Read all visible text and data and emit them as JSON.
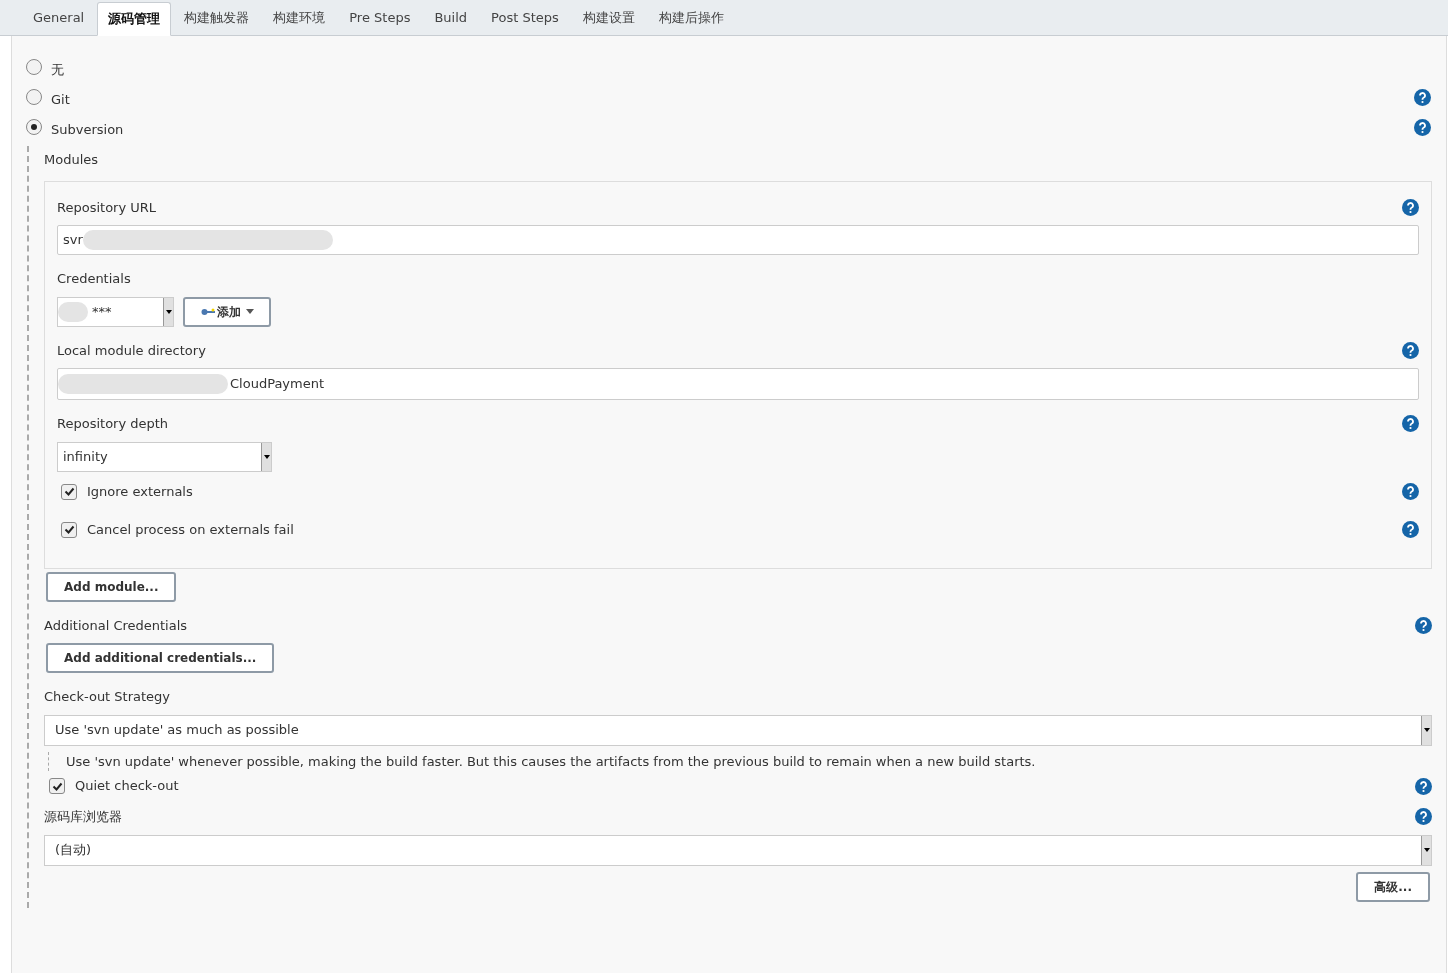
{
  "tabs": [
    {
      "label": "General",
      "selected": false
    },
    {
      "label": "源码管理",
      "selected": true
    },
    {
      "label": "构建触发器",
      "selected": false
    },
    {
      "label": "构建环境",
      "selected": false
    },
    {
      "label": "Pre Steps",
      "selected": false
    },
    {
      "label": "Build",
      "selected": false
    },
    {
      "label": "Post Steps",
      "selected": false
    },
    {
      "label": "构建设置",
      "selected": false
    },
    {
      "label": "构建后操作",
      "selected": false
    }
  ],
  "scm_options": [
    {
      "label": "无",
      "selected": false,
      "help": false
    },
    {
      "label": "Git",
      "selected": false,
      "help": true
    },
    {
      "label": "Subversion",
      "selected": true,
      "help": true
    }
  ],
  "modules": {
    "label": "Modules",
    "repository_url": {
      "label": "Repository URL",
      "value": "svr"
    },
    "credentials": {
      "label": "Credentials",
      "value": "***",
      "add_button": "添加"
    },
    "local_module_directory": {
      "label": "Local module directory",
      "value": "CloudPayment"
    },
    "repository_depth": {
      "label": "Repository depth",
      "value": "infinity"
    },
    "options": [
      {
        "label": "Ignore externals",
        "checked": true
      },
      {
        "label": "Cancel process on externals fail",
        "checked": true
      }
    ],
    "add_button": "Add module..."
  },
  "additional_credentials": {
    "label": "Additional Credentials",
    "button": "Add additional credentials..."
  },
  "checkout_strategy": {
    "label": "Check-out Strategy",
    "value": "Use 'svn update' as much as possible",
    "description": "Use 'svn update' whenever possible, making the build faster. But this causes the artifacts from the previous build to remain when a new build starts."
  },
  "quiet_checkout": {
    "label": "Quiet check-out",
    "checked": true
  },
  "repository_browser": {
    "label": "源码库浏览器",
    "value": "(自动)"
  },
  "advanced_button": "高级..."
}
